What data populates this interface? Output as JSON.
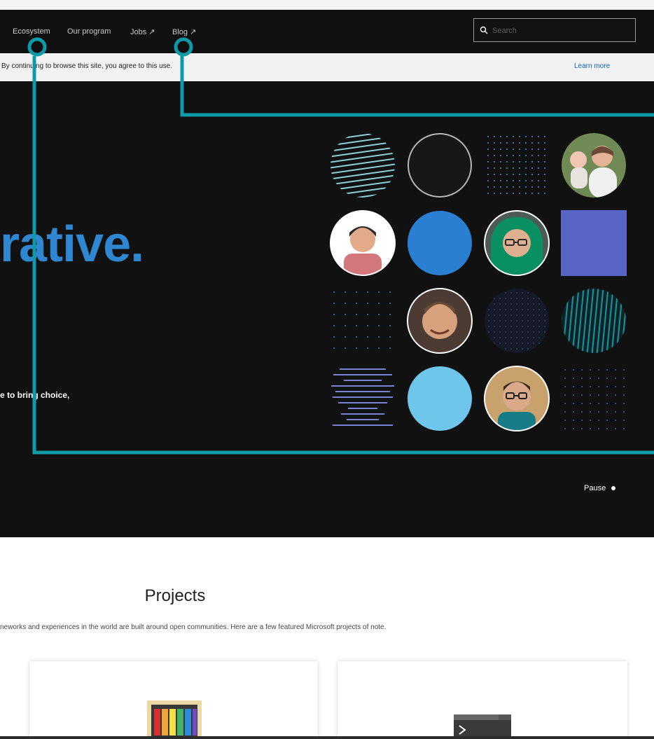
{
  "nav": {
    "items": [
      "Ecosystem",
      "Our program",
      "Jobs ↗",
      "Blog ↗"
    ]
  },
  "search": {
    "placeholder": "Search"
  },
  "cookie_banner": {
    "text": "By continuing to browse this site, you agree to this use.",
    "link": "Learn more"
  },
  "hero": {
    "headline": "rative.",
    "text": "e to bring choice,",
    "pause_label": "Pause"
  },
  "projects": {
    "title": "Projects",
    "description": "neworks and experiences in the world are built around open communities. Here are a few featured Microsoft projects of note."
  },
  "colors": {
    "nav_bg": "#101010",
    "hero_bg": "#111111",
    "accent_blue": "#2f86d1",
    "callout_teal": "#0e9aa7",
    "light_blue": "#6ec6ea"
  },
  "icons": {
    "search": "search-icon",
    "pause": "pause-dot-icon",
    "callout": "callout-marker-icon"
  }
}
